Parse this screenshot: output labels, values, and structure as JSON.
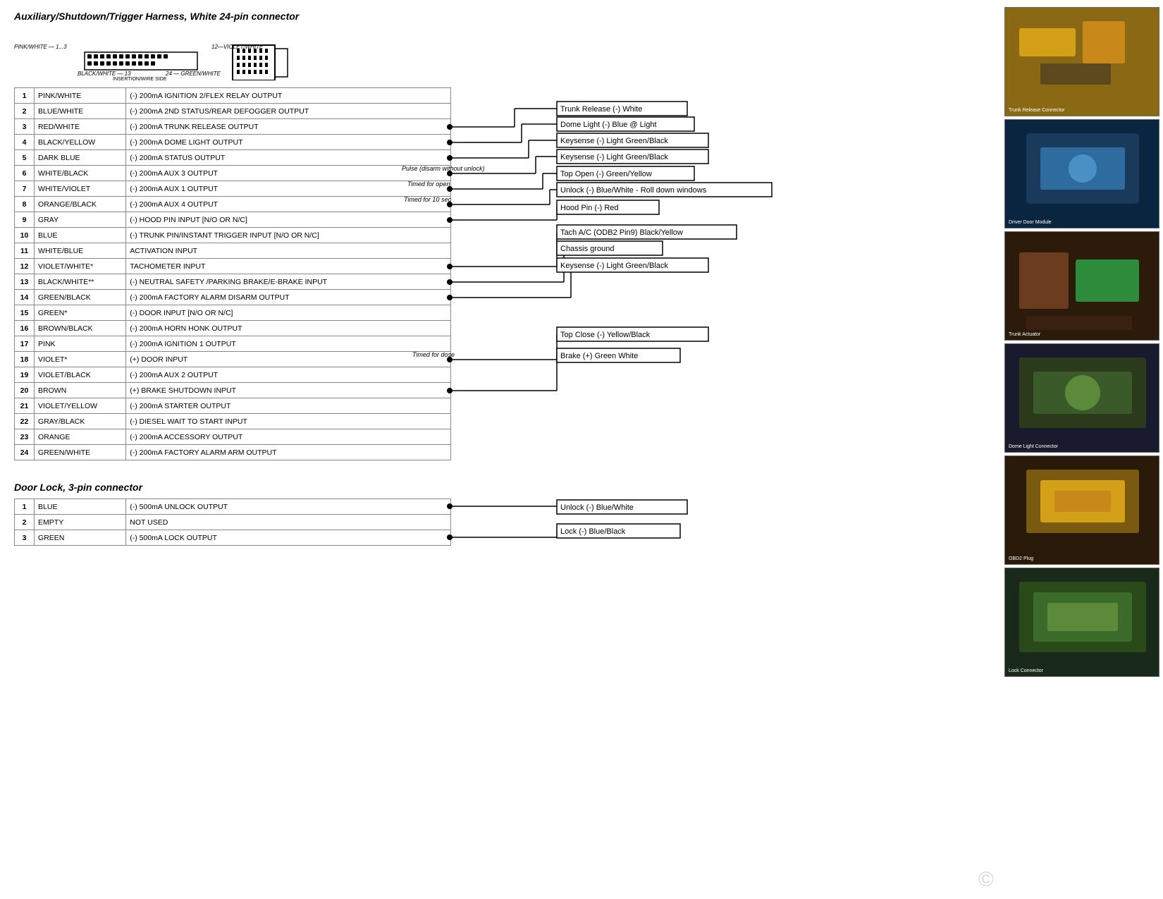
{
  "page": {
    "title": "Auxiliary/Shutdown/Trigger Harness, White 24-pin connector",
    "section2_title": "Door Lock, 3-pin connector"
  },
  "main_table": {
    "rows": [
      {
        "num": "1",
        "color": "PINK/WHITE",
        "desc": "(-) 200mA IGNITION 2/FLEX RELAY OUTPUT"
      },
      {
        "num": "2",
        "color": "BLUE/WHITE",
        "desc": "(-) 200mA 2ND STATUS/REAR DEFOGGER OUTPUT"
      },
      {
        "num": "3",
        "color": "RED/WHITE",
        "desc": "(-) 200mA TRUNK RELEASE OUTPUT"
      },
      {
        "num": "4",
        "color": "BLACK/YELLOW",
        "desc": "(-) 200mA DOME LIGHT OUTPUT"
      },
      {
        "num": "5",
        "color": "DARK BLUE",
        "desc": "(-) 200mA STATUS OUTPUT"
      },
      {
        "num": "6",
        "color": "WHITE/BLACK",
        "desc": "(-) 200mA AUX 3 OUTPUT"
      },
      {
        "num": "7",
        "color": "WHITE/VIOLET",
        "desc": "(-) 200mA AUX 1 OUTPUT"
      },
      {
        "num": "8",
        "color": "ORANGE/BLACK",
        "desc": "(-) 200mA AUX 4 OUTPUT"
      },
      {
        "num": "9",
        "color": "GRAY",
        "desc": "(-) HOOD PIN INPUT [N/O OR N/C]"
      },
      {
        "num": "10",
        "color": "BLUE",
        "desc": "(-) TRUNK PIN/INSTANT TRIGGER INPUT [N/O OR N/C]"
      },
      {
        "num": "11",
        "color": "WHITE/BLUE",
        "desc": "ACTIVATION INPUT"
      },
      {
        "num": "12",
        "color": "VIOLET/WHITE*",
        "desc": "TACHOMETER INPUT"
      },
      {
        "num": "13",
        "color": "BLACK/WHITE**",
        "desc": "(-) NEUTRAL SAFETY /PARKING BRAKE/E-BRAKE INPUT"
      },
      {
        "num": "14",
        "color": "GREEN/BLACK",
        "desc": "(-) 200mA FACTORY ALARM DISARM OUTPUT"
      },
      {
        "num": "15",
        "color": "GREEN*",
        "desc": "(-) DOOR INPUT [N/O OR N/C]"
      },
      {
        "num": "16",
        "color": "BROWN/BLACK",
        "desc": "(-) 200mA HORN HONK OUTPUT"
      },
      {
        "num": "17",
        "color": "PINK",
        "desc": "(-) 200mA IGNITION 1 OUTPUT"
      },
      {
        "num": "18",
        "color": "VIOLET*",
        "desc": "(+) DOOR INPUT"
      },
      {
        "num": "19",
        "color": "VIOLET/BLACK",
        "desc": "(-) 200mA AUX 2 OUTPUT"
      },
      {
        "num": "20",
        "color": "BROWN",
        "desc": "(+) BRAKE SHUTDOWN INPUT"
      },
      {
        "num": "21",
        "color": "VIOLET/YELLOW",
        "desc": "(-) 200mA STARTER OUTPUT"
      },
      {
        "num": "22",
        "color": "GRAY/BLACK",
        "desc": "(-) DIESEL WAIT TO START INPUT"
      },
      {
        "num": "23",
        "color": "ORANGE",
        "desc": "(-) 200mA ACCESSORY OUTPUT"
      },
      {
        "num": "24",
        "color": "GREEN/WHITE",
        "desc": "(-) 200mA FACTORY ALARM ARM OUTPUT"
      }
    ]
  },
  "door_lock_table": {
    "rows": [
      {
        "num": "1",
        "color": "BLUE",
        "desc": "(-) 500mA UNLOCK OUTPUT"
      },
      {
        "num": "2",
        "color": "EMPTY",
        "desc": "NOT USED"
      },
      {
        "num": "3",
        "color": "GREEN",
        "desc": "(-) 500mA LOCK OUTPUT"
      }
    ]
  },
  "annotations_main": [
    {
      "id": "a1",
      "label": "Trunk Release (-) White",
      "row": 3
    },
    {
      "id": "a2",
      "label": "Dome Light (-) Blue @ Light",
      "row": 4
    },
    {
      "id": "a3",
      "label": "Keysense (-) Light Green/Black",
      "row": 5
    },
    {
      "id": "a4",
      "label": "Pulse (disarm without unlock)",
      "row": 6,
      "side_note": true
    },
    {
      "id": "a4b",
      "label": "Keysense (-) Light Green/Black",
      "row": 6
    },
    {
      "id": "a5",
      "label": "Timed for open",
      "row": 7,
      "side_note": true
    },
    {
      "id": "a5b",
      "label": "Top Open (-) Green/Yellow",
      "row": 7
    },
    {
      "id": "a6",
      "label": "Timed for 10 sec",
      "row": 8,
      "side_note": true
    },
    {
      "id": "a6b",
      "label": "Unlock (-) Blue/White - Roll down windows",
      "row": 8
    },
    {
      "id": "a7",
      "label": "Hood Pin (-) Red",
      "row": 9
    },
    {
      "id": "a8",
      "label": "Tach A/C (ODB2 Pin9) Black/Yellow",
      "row": 12
    },
    {
      "id": "a9",
      "label": "Chassis ground",
      "row": 13
    },
    {
      "id": "a10",
      "label": "Keysense (-) Light Green/Black",
      "row": 14
    },
    {
      "id": "a11",
      "label": "Timed for dose",
      "row": 18,
      "side_note": true
    },
    {
      "id": "a11b",
      "label": "Top Close (-) Yellow/Black",
      "row": 18
    },
    {
      "id": "a12",
      "label": "Brake (+) Green White",
      "row": 20
    }
  ],
  "annotations_door": [
    {
      "id": "d1",
      "label": "Unlock (-) Blue/White",
      "row": 1
    },
    {
      "id": "d3",
      "label": "Lock (-) Blue/Black",
      "row": 3
    }
  ],
  "photos": [
    {
      "id": "p1",
      "alt": "Wiring photo 1 - yellow connectors"
    },
    {
      "id": "p2",
      "alt": "Wiring photo 2 - blue wires door module"
    },
    {
      "id": "p3",
      "alt": "Wiring photo 3 - trunk release connector"
    },
    {
      "id": "p4",
      "alt": "Wiring photo 4 - dome light connector"
    },
    {
      "id": "p5",
      "alt": "Wiring photo 5 - harness plug"
    },
    {
      "id": "p6",
      "alt": "Wiring photo 6 - lock connector"
    }
  ]
}
